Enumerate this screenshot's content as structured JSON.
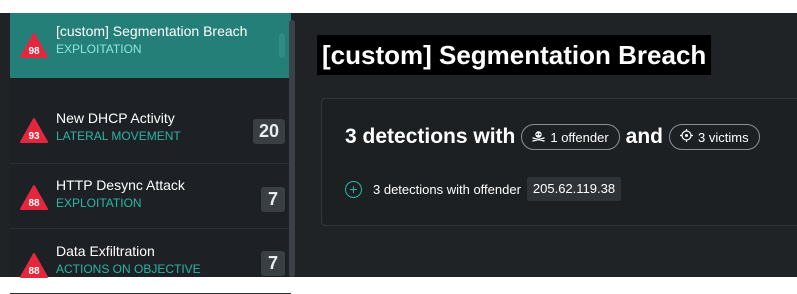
{
  "sidebar": {
    "items": [
      {
        "score": "98",
        "title": "[custom] Segmentation Breach",
        "category": "EXPLOITATION",
        "count": ""
      },
      {
        "score": "93",
        "title": "New DHCP Activity",
        "category": "LATERAL MOVEMENT",
        "count": "20"
      },
      {
        "score": "88",
        "title": "HTTP Desync Attack",
        "category": "EXPLOITATION",
        "count": "7"
      },
      {
        "score": "88",
        "title": "Data Exfiltration",
        "category": "ACTIONS ON OBJECTIVE",
        "count": "7"
      }
    ]
  },
  "main": {
    "title": "[custom] Segmentation Breach",
    "summary": {
      "prefix": "3 detections with",
      "offender_pill": "1 offender",
      "conjunction": "and",
      "victims_pill": "3 victims"
    },
    "detail": {
      "text": "3 detections with offender",
      "ip": "205.62.119.38"
    }
  },
  "colors": {
    "accent": "#247f78",
    "category_text": "#2bb6a4",
    "badge_red": "#e5273e"
  },
  "icons": {
    "badge": "triangle-score-icon",
    "offender": "skull-icon",
    "victims": "target-icon",
    "expand": "plus-circle-icon"
  }
}
